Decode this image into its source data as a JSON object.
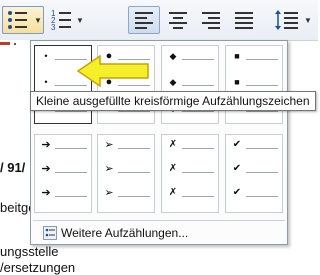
{
  "toolbar": {
    "buttons": [
      {
        "name": "bullet-list",
        "icon": "bullet-list-icon"
      },
      {
        "name": "numbered-list",
        "icon": "numbered-list-icon"
      },
      {
        "name": "align-left",
        "icon": "align-left-icon"
      },
      {
        "name": "align-center",
        "icon": "align-center-icon"
      },
      {
        "name": "align-right",
        "icon": "align-right-icon"
      },
      {
        "name": "justify",
        "icon": "justify-icon"
      },
      {
        "name": "line-spacing",
        "icon": "line-spacing-icon"
      }
    ],
    "numbered_list_digits": [
      "1",
      "2",
      "3"
    ]
  },
  "document": {
    "lines": [
      "/ 91/",
      "beitge",
      "ungsstelle",
      "/ersetzungen"
    ]
  },
  "gallery": {
    "tiles": [
      {
        "glyph": "•"
      },
      {
        "glyph": "●"
      },
      {
        "glyph": "◆"
      },
      {
        "glyph": "■"
      },
      {
        "glyph": "➔"
      },
      {
        "glyph": "➢"
      },
      {
        "glyph": "✗"
      },
      {
        "glyph": "✔"
      }
    ],
    "more_label": "Weitere Aufzählungen..."
  },
  "tooltip": {
    "text": "Kleine ausgefüllte kreisförmige Aufzählungszeichen"
  },
  "colors": {
    "highlight_arrow": "#f5ee2a",
    "arrow_outline": "#c9a400",
    "selected_border": "#7a9cc9"
  }
}
